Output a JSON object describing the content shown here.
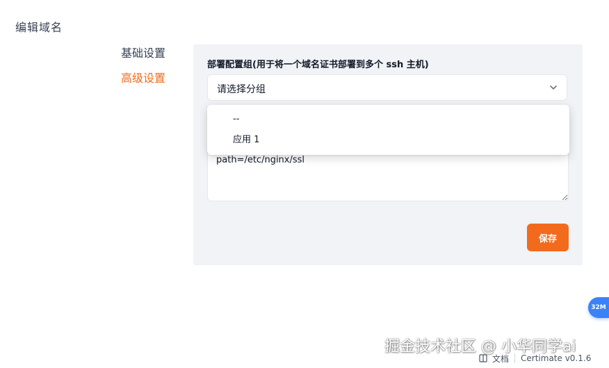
{
  "page": {
    "title": "编辑域名"
  },
  "side_nav": {
    "items": [
      {
        "label": "基础设置",
        "active": false
      },
      {
        "label": "高级设置",
        "active": true
      }
    ]
  },
  "form": {
    "deploy_group_label": "部署配置组(用于将一个域名证书部署到多个 ssh 主机)",
    "select_placeholder": "请选择分组",
    "textarea_value": "path=/etc/nginx/ssl",
    "save_label": "保存"
  },
  "dropdown": {
    "options": [
      {
        "label": "--"
      },
      {
        "label": "应用 1"
      }
    ]
  },
  "badge": {
    "text": "32M"
  },
  "footer": {
    "docs_label": "文档",
    "version": "Certimate v0.1.6"
  },
  "watermark": {
    "text": "掘金技术社区 @ 小华同学ai"
  },
  "colors": {
    "accent": "#f26b1d",
    "panel_bg": "#f1f3f6",
    "badge_bg": "#3b82f6"
  },
  "icons": {
    "select_chevron": "chevron-down-icon",
    "docs": "book-icon"
  }
}
